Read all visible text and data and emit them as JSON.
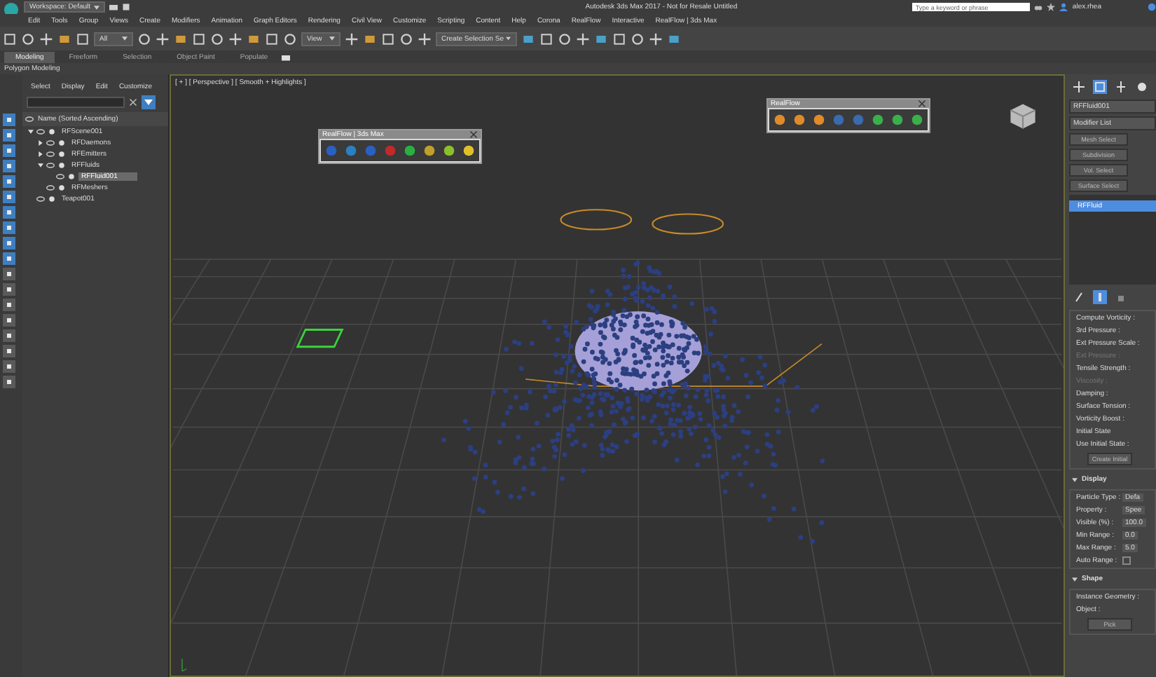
{
  "title_bar": {
    "workspace": "Workspace: Default",
    "title": "Autodesk 3ds Max 2017 - Not for Resale   Untitled",
    "search": {
      "placeholder": "Type a keyword or phrase"
    },
    "user": "alex.rhea"
  },
  "menu": [
    "Edit",
    "Tools",
    "Group",
    "Views",
    "Create",
    "Modifiers",
    "Animation",
    "Graph Editors",
    "Rendering",
    "Civil View",
    "Customize",
    "Scripting",
    "Content",
    "Help",
    "Corona",
    "RealFlow",
    "Interactive",
    "RealFlow | 3ds Max"
  ],
  "toolbar": {
    "selection_filter": "All",
    "reference_coord": "View",
    "selection_set": "Create Selection Se"
  },
  "ribbon": {
    "tabs": [
      {
        "label": "Modeling",
        "selected": true
      },
      {
        "label": "Freeform",
        "selected": false
      },
      {
        "label": "Selection",
        "selected": false
      },
      {
        "label": "Object Paint",
        "selected": false
      },
      {
        "label": "Populate",
        "selected": false
      }
    ],
    "subtitle": "Polygon Modeling"
  },
  "scene_explorer": {
    "tabs": [
      "Select",
      "Display",
      "Edit",
      "Customize"
    ],
    "header": "Name (Sorted Ascending)",
    "tree": [
      {
        "label": "RFScene001",
        "expanded": true,
        "selected": false,
        "children": [
          {
            "label": "RFDaemons",
            "expanded": false,
            "selected": false
          },
          {
            "label": "RFEmitters",
            "expanded": false,
            "selected": false
          },
          {
            "label": "RFFluids",
            "expanded": true,
            "selected": false,
            "children": [
              {
                "label": "RFFluid001",
                "selected": true
              }
            ]
          },
          {
            "label": "RFMeshers",
            "selected": false
          }
        ]
      },
      {
        "label": "Teapot001",
        "selected": false
      }
    ]
  },
  "viewport": {
    "label": "[ + ] [ Perspective ] [ Smooth + Highlights ]"
  },
  "floating_toolbars": [
    {
      "title": "RealFlow | 3ds Max"
    },
    {
      "title": "RealFlow"
    }
  ],
  "command_panel": {
    "object_name": "RFFluid001",
    "modifier_list": "Modifier List",
    "modifier_buttons": [
      "Mesh Select",
      "Subdivision",
      "Vol. Select",
      "Surface Select"
    ],
    "stack": [
      {
        "label": "RFFluid",
        "selected": true
      }
    ],
    "parameters": [
      {
        "label": "Compute Vorticity :",
        "disabled": false
      },
      {
        "label": "3rd Pressure :",
        "disabled": false
      },
      {
        "label": "Ext Pressure Scale :",
        "disabled": false
      },
      {
        "label": "Ext Pressure :",
        "disabled": true
      },
      {
        "label": "Tensile Strength :",
        "disabled": false
      },
      {
        "label": "Viscosity :",
        "disabled": true
      },
      {
        "label": "Damping :",
        "disabled": false
      },
      {
        "label": "Surface Tension :",
        "disabled": false
      },
      {
        "label": "Vorticity Boost :",
        "disabled": false
      }
    ],
    "initial_state": {
      "title": "Initial State",
      "option": "Use Initial State :",
      "button": "Create Initial"
    },
    "display": {
      "title": "Display",
      "fields": [
        {
          "label": "Particle Type :",
          "value": "Defa"
        },
        {
          "label": "Property :",
          "value": "Spee"
        },
        {
          "label": "Visible (%) :",
          "value": "100.0"
        },
        {
          "label": "Min Range :",
          "value": "0.0"
        },
        {
          "label": "Max Range :",
          "value": "5.0"
        }
      ],
      "auto_range": {
        "label": "Auto Range :",
        "checked": false
      }
    },
    "shape": {
      "title": "Shape",
      "fields": [
        "Instance Geometry :",
        "Object :"
      ],
      "button": "Pick"
    }
  }
}
